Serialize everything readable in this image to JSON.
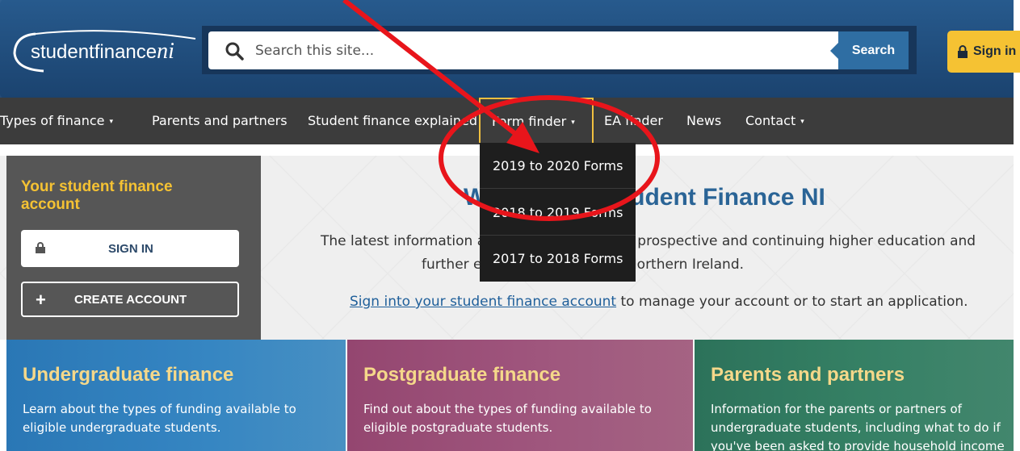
{
  "logo": {
    "brand": "studentfinance",
    "brand_suffix": "ni"
  },
  "search": {
    "placeholder": "Search this site...",
    "button_label": "Search"
  },
  "header": {
    "sign_in_label": "Sign in"
  },
  "nav": {
    "items": [
      {
        "label": "Types of finance",
        "has_caret": true
      },
      {
        "label": "Parents and partners",
        "has_caret": false
      },
      {
        "label": "Student finance explained",
        "has_caret": false
      },
      {
        "label": "Form finder",
        "has_caret": true
      },
      {
        "label": "EA finder",
        "has_caret": false
      },
      {
        "label": "News",
        "has_caret": false
      },
      {
        "label": "Contact",
        "has_caret": true
      }
    ],
    "caret": "▾"
  },
  "dropdown": {
    "items": [
      "2019 to 2020 Forms",
      "2018 to 2019 Forms",
      "2017 to 2018 Forms"
    ]
  },
  "account_panel": {
    "title": "Your student finance account",
    "sign_in_label": "SIGN IN",
    "create_label": "CREATE ACCOUNT"
  },
  "welcome": {
    "title": "Welcome to Student Finance NI",
    "line1": "The latest information and online services for prospective and continuing higher education and",
    "line2": "further education students in Northern Ireland.",
    "signin_link": "Sign into your student finance account",
    "signin_rest": " to manage your account or to start an application."
  },
  "cards": [
    {
      "title": "Undergraduate finance",
      "text": "Learn about the types of funding available to eligible undergraduate students."
    },
    {
      "title": "Postgraduate finance",
      "text": "Find out about the types of funding available to eligible postgraduate students."
    },
    {
      "title": "Parents and partners",
      "text": "Information for the parents or partners of undergraduate students, including what to do if you've been asked to provide household income"
    }
  ],
  "colors": {
    "accent": "#f5c233",
    "annotation": "#e8151b",
    "header": "#1f4a7a",
    "nav": "#3c3c3c"
  }
}
